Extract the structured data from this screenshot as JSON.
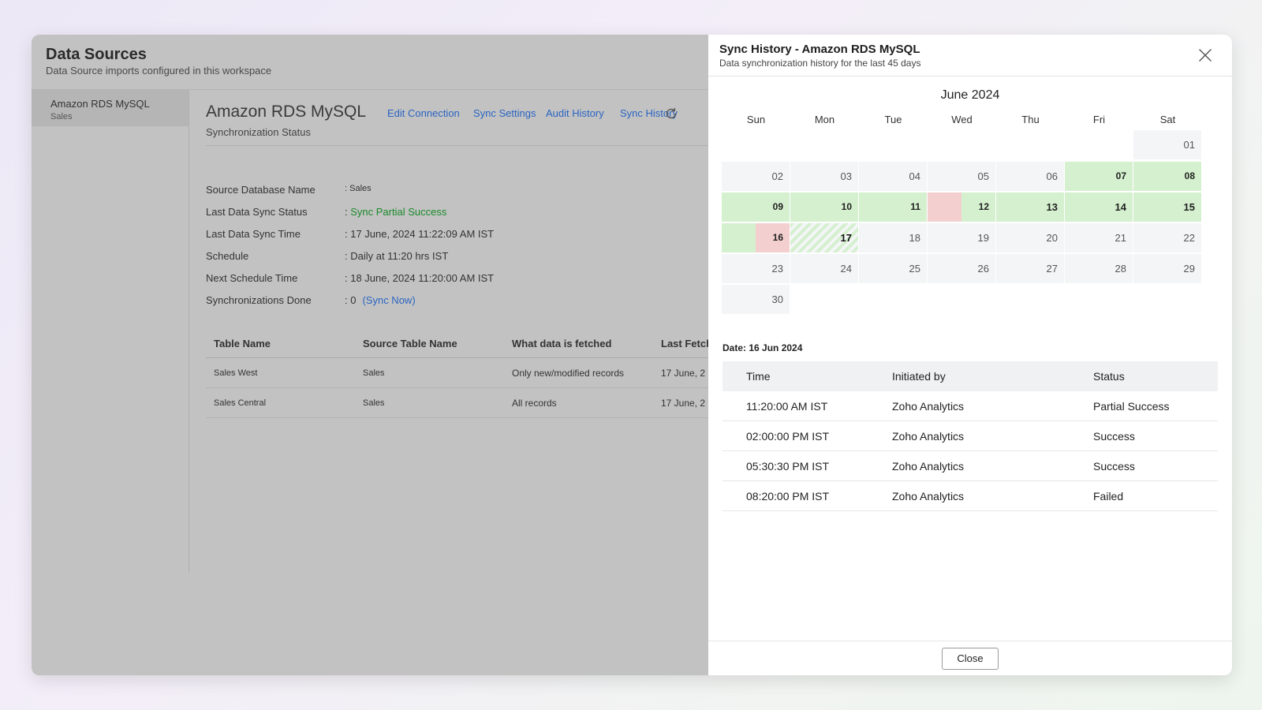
{
  "header": {
    "title": "Data Sources",
    "subtitle": "Data Source imports configured in this workspace"
  },
  "sidebar": {
    "items": [
      {
        "name": "Amazon RDS MySQL",
        "sub": "Sales"
      }
    ]
  },
  "main": {
    "title": "Amazon RDS MySQL",
    "links": [
      "Edit Connection",
      "Sync Settings",
      "Audit History",
      "Sync History"
    ],
    "refresh_icon": "refresh-icon",
    "status_heading": "Synchronization Status",
    "info": [
      {
        "label": "Source Database Name",
        "value": ": Sales"
      },
      {
        "label": "Last Data Sync Status",
        "value_prefix": ": ",
        "value": "Sync Partial Success"
      },
      {
        "label": "Last Data Sync Time",
        "value": ": 17 June, 2024 11:22:09 AM IST"
      },
      {
        "label": "Schedule",
        "value": ": Daily at 11:20 hrs IST"
      },
      {
        "label": "Next Schedule Time",
        "value": ": 18 June, 2024 11:20:00 AM IST"
      },
      {
        "label": "Synchronizations Done",
        "value": ": 0",
        "link": "(Sync Now)"
      }
    ],
    "table": {
      "columns": [
        "Table Name",
        "Source Table Name",
        "What data is fetched",
        "Last Fetch"
      ],
      "rows": [
        [
          "Sales West",
          "Sales",
          "Only new/modified records",
          "17 June, 2"
        ],
        [
          "Sales Central",
          "Sales",
          "All records",
          "17 June, 2"
        ]
      ]
    }
  },
  "panel": {
    "title": "Sync History - Amazon RDS MySQL",
    "subtitle": "Data synchronization history for the last 45 days",
    "close_icon": "close-icon",
    "calendar": {
      "month": "June 2024",
      "days": [
        "Sun",
        "Mon",
        "Tue",
        "Wed",
        "Thu",
        "Fri",
        "Sat"
      ],
      "cells": [
        {
          "d": "01"
        },
        {
          "d": "02"
        },
        {
          "d": "03"
        },
        {
          "d": "04"
        },
        {
          "d": "05"
        },
        {
          "d": "06"
        },
        {
          "d": "07",
          "status": "success"
        },
        {
          "d": "08",
          "status": "success"
        },
        {
          "d": "09",
          "status": "success"
        },
        {
          "d": "10",
          "status": "success"
        },
        {
          "d": "11",
          "status": "success"
        },
        {
          "d": "12",
          "status": "partial"
        },
        {
          "d": "13",
          "status": "success"
        },
        {
          "d": "14",
          "status": "success"
        },
        {
          "d": "15",
          "status": "success"
        },
        {
          "d": "16",
          "status": "partial-selected"
        },
        {
          "d": "17",
          "status": "in-progress"
        },
        {
          "d": "18"
        },
        {
          "d": "19"
        },
        {
          "d": "20"
        },
        {
          "d": "21"
        },
        {
          "d": "22"
        },
        {
          "d": "23"
        },
        {
          "d": "24"
        },
        {
          "d": "25"
        },
        {
          "d": "26"
        },
        {
          "d": "27"
        },
        {
          "d": "28"
        },
        {
          "d": "29"
        },
        {
          "d": "30"
        }
      ],
      "colors": {
        "success": "#d4f0ce",
        "failed": "#f3cfcf",
        "empty": "#f4f5f7"
      }
    },
    "date_label": "Date: 16 Jun 2024",
    "history": {
      "columns": [
        "Time",
        "Initiated by",
        "Status"
      ],
      "rows": [
        {
          "time": "11:20:00 AM IST",
          "by": "Zoho Analytics",
          "status": "Partial Success"
        },
        {
          "time": "02:00:00 PM IST",
          "by": "Zoho Analytics",
          "status": "Success"
        },
        {
          "time": "05:30:30 PM IST",
          "by": "Zoho Analytics",
          "status": "Success"
        },
        {
          "time": "08:20:00 PM IST",
          "by": "Zoho Analytics",
          "status": "Failed"
        }
      ]
    },
    "close_button": "Close"
  }
}
